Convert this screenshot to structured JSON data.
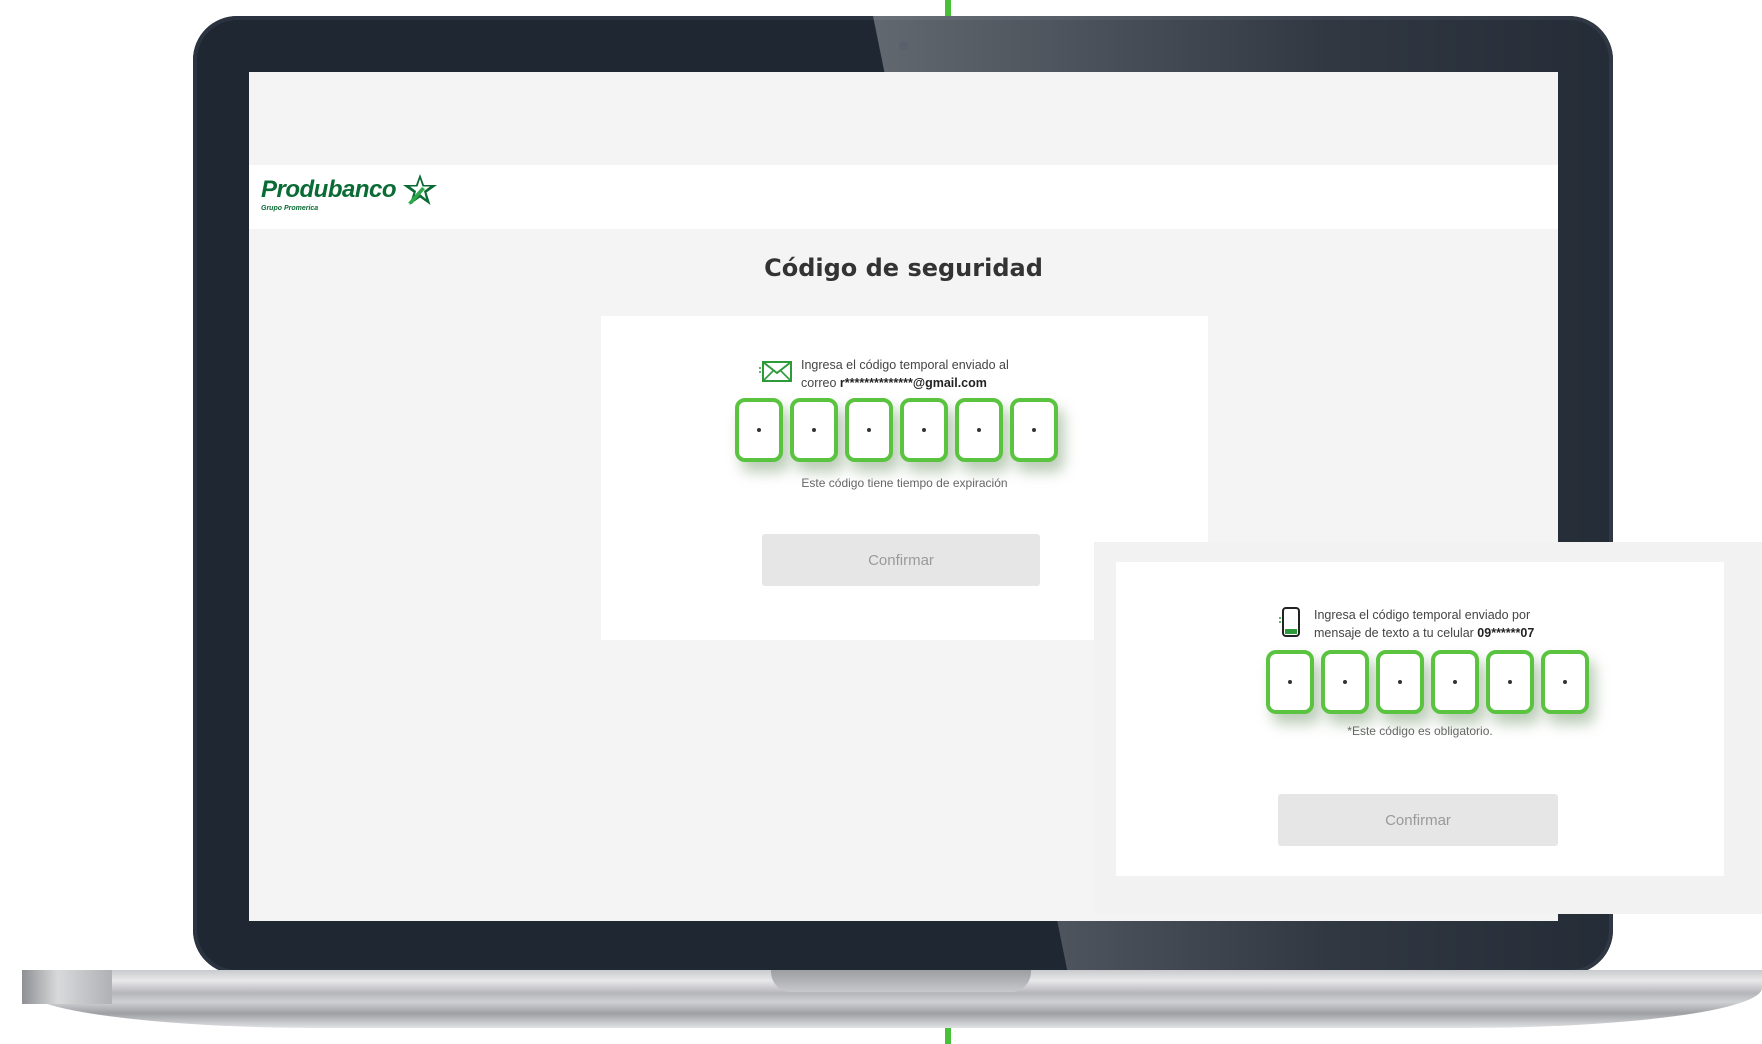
{
  "brand": {
    "name": "Produbanco",
    "subtitle": "Grupo Promerica",
    "primary_color": "#0a6b35",
    "accent_color": "#5ac33f"
  },
  "page": {
    "title": "Código de seguridad"
  },
  "email_verification": {
    "icon": "envelope-icon",
    "instruction_line1": "Ingresa el código temporal enviado al",
    "instruction_prefix": "correo ",
    "masked_email": "r**************@gmail.com",
    "code_digits": [
      "•",
      "•",
      "•",
      "•",
      "•",
      "•"
    ],
    "hint": "Este código tiene tiempo de expiración",
    "confirm_label": "Confirmar"
  },
  "sms_verification": {
    "icon": "mobile-phone-icon",
    "instruction_line1": "Ingresa el código temporal enviado por",
    "instruction_prefix": "mensaje de texto a tu celular ",
    "masked_phone": "09******07",
    "code_digits": [
      "•",
      "•",
      "•",
      "•",
      "•",
      "•"
    ],
    "hint": "*Este código es obligatorio.",
    "confirm_label": "Confirmar"
  }
}
